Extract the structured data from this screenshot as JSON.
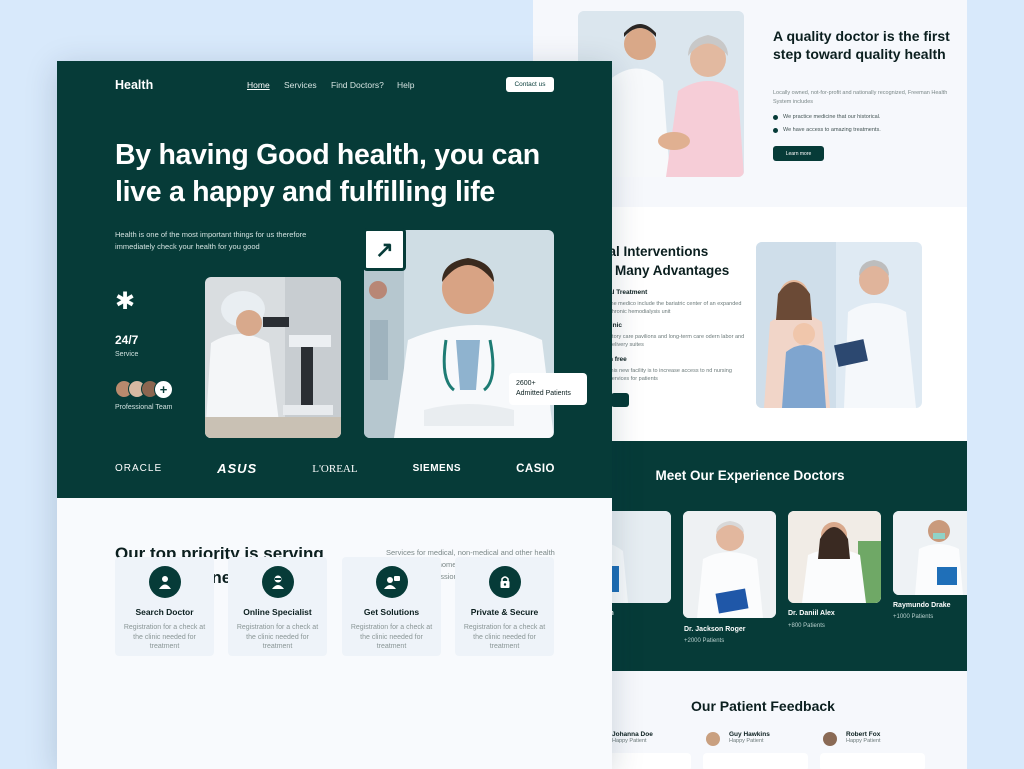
{
  "colors": {
    "brand_dark": "#063b38",
    "page_bg": "#d8e9fb",
    "white": "#ffffff"
  },
  "front": {
    "logo": "Health",
    "nav": [
      {
        "label": "Home",
        "active": true
      },
      {
        "label": "Services"
      },
      {
        "label": "Find Doctors?"
      },
      {
        "label": "Help"
      }
    ],
    "contact_label": "Contact us",
    "hero_title": "By having Good health, you can live a happy and fulfilling life",
    "hero_lead": "Health is one of the most important things for us therefore immediately check your health for you good",
    "stat_value": "24/7",
    "stat_label": "Service",
    "team_label": "Professional Team",
    "plus_icon": "+",
    "patients_count": "2600+",
    "patients_label": "Admitted Patients",
    "brands": [
      "ORACLE",
      "ASUS",
      "L'OREAL",
      "SIEMENS",
      "CASIO"
    ],
    "priority_title": "Our top priority is serving your health needs",
    "priority_desc": "Services for medical, non-medical and other health needs tpo your home by trained and professional healthcare professional.",
    "cards": [
      {
        "title": "Search Doctor",
        "desc": "Registration for a check at the  clinic needed for treatment",
        "icon": "doctor-icon"
      },
      {
        "title": "Online Specialist",
        "desc": "Registration for a check at the  clinic needed for treatment",
        "icon": "specialist-icon"
      },
      {
        "title": "Get Solutions",
        "desc": "Registration for a check at the  clinic needed for treatment",
        "icon": "solutions-icon"
      },
      {
        "title": "Private & Secure",
        "desc": "Registration for a check at the  clinic needed for treatment",
        "icon": "lock-icon"
      }
    ]
  },
  "back": {
    "quality_title": "A quality doctor is the first step toward quality health",
    "quality_desc": "Locally owned, not-for-profit and nationally recognized, Freeman Health System includes",
    "bullets": [
      "We practice medicine that our historical.",
      "We have access to amazing treatments."
    ],
    "learn_more": "Learn more",
    "interventions_title_1": "cal Interventions",
    "interventions_title_2": "Many Advantages",
    "interventions": [
      {
        "head": "al Treatment",
        "text": "the medico include the bariatric center of an expanded chronic hemodialysis unit"
      },
      {
        "head": "linic",
        "text": "atory care pavilions and long-term care odern labor and delivery suites"
      },
      {
        "head": "n free",
        "text": "this new facility is to increase access to nd nursing services for patients"
      }
    ],
    "meet_title": "Meet Our Experience Doctors",
    "doctors": [
      {
        "name": "nson",
        "sub": "nts"
      },
      {
        "name": "Dr. Jackson Roger",
        "sub": "+2000 Patients"
      },
      {
        "name": "Dr. Daniil Alex",
        "sub": "+800 Patients"
      },
      {
        "name": "Raymundo Drake",
        "sub": "+1000 Patients"
      }
    ],
    "feedback_title": "Our Patient Feedback",
    "feedback": [
      {
        "name": "Johanna Doe",
        "sub": "Happy Patient"
      },
      {
        "name": "Guy Hawkins",
        "sub": "Happy Patient"
      },
      {
        "name": "Robert Fox",
        "sub": "Happy Patient"
      }
    ]
  }
}
